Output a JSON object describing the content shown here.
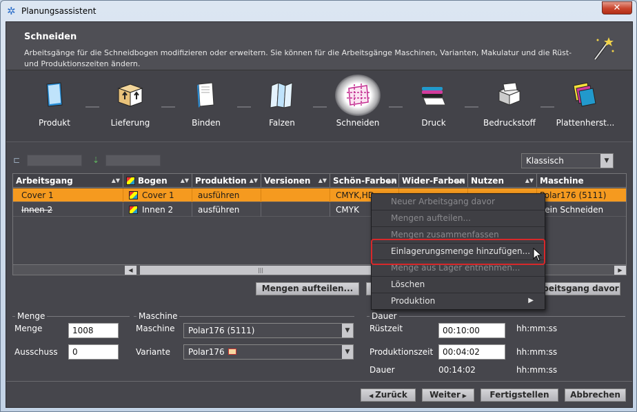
{
  "window": {
    "title": "Planungsassistent",
    "close_label": "✕"
  },
  "header": {
    "title": "Schneiden",
    "description": "Arbeitsgänge für die Schneidbogen modifizieren oder erweitern. Sie können für die Arbeitsgänge Maschinen, Varianten, Makulatur und die Rüst- und Produktionszeiten ändern."
  },
  "steps": [
    {
      "label": "Produkt",
      "icon": "produkt-icon"
    },
    {
      "label": "Lieferung",
      "icon": "lieferung-icon"
    },
    {
      "label": "Binden",
      "icon": "binden-icon"
    },
    {
      "label": "Falzen",
      "icon": "falzen-icon"
    },
    {
      "label": "Schneiden",
      "icon": "schneiden-icon",
      "active": true
    },
    {
      "label": "Druck",
      "icon": "druck-icon"
    },
    {
      "label": "Bedruckstoff",
      "icon": "bedruckstoff-icon"
    },
    {
      "label": "Plattenherst...",
      "icon": "plattenherst-icon"
    }
  ],
  "view_select": {
    "value": "Klassisch"
  },
  "table": {
    "columns": [
      "Arbeitsgang",
      "Bogen",
      "Produktion",
      "Versionen",
      "Schön-Farben",
      "Wider-Farben",
      "Nutzen",
      "Maschine"
    ],
    "rows": [
      {
        "arbeitsgang": "Cover 1",
        "bogen": "Cover 1",
        "produktion": "ausführen",
        "versionen": "",
        "schoen": "CMYK,HD",
        "wider": "",
        "nutzen": "",
        "maschine": "Polar176 (5111)"
      },
      {
        "arbeitsgang": "Innen 2",
        "bogen": "Innen 2",
        "produktion": "ausführen",
        "versionen": "",
        "schoen": "CMYK",
        "wider": "",
        "nutzen": "",
        "maschine": "Kein Schneiden"
      }
    ]
  },
  "buttons": {
    "mengen_aufteilen": "Mengen aufteilen...",
    "arbeitsgang_davor": "rbeitsgang davor"
  },
  "menge": {
    "group_title": "Menge",
    "menge_label": "Menge",
    "menge_value": "1008",
    "ausschuss_label": "Ausschuss",
    "ausschuss_value": "0"
  },
  "maschine": {
    "group_title": "Maschine",
    "maschine_label": "Maschine",
    "maschine_value": "Polar176 (5111)",
    "variante_label": "Variante",
    "variante_value": "Polar176"
  },
  "dauer": {
    "group_title": "Dauer",
    "ruestzeit_label": "Rüstzeit",
    "ruestzeit_value": "00:10:00",
    "produktionszeit_label": "Produktionszeit",
    "produktionszeit_value": "00:04:02",
    "dauer_label": "Dauer",
    "dauer_value": "00:14:02",
    "unit": "hh:mm:ss"
  },
  "context_menu": {
    "items": [
      {
        "label": "Neuer Arbeitsgang davor",
        "disabled": true
      },
      {
        "label": "Mengen aufteilen...",
        "disabled": true
      },
      {
        "label": "Mengen zusammenfassen",
        "disabled": true
      },
      {
        "label": "Einlagerungsmenge hinzufügen...",
        "disabled": false
      },
      {
        "label": "Menge aus Lager entnehmen...",
        "disabled": true
      },
      {
        "label": "Löschen",
        "disabled": false
      },
      {
        "label": "Produktion",
        "disabled": false,
        "submenu": true
      }
    ]
  },
  "footer": {
    "zurueck": "Zurück",
    "weiter": "Weiter",
    "fertigstellen": "Fertigstellen",
    "abbrechen": "Abbrechen"
  }
}
